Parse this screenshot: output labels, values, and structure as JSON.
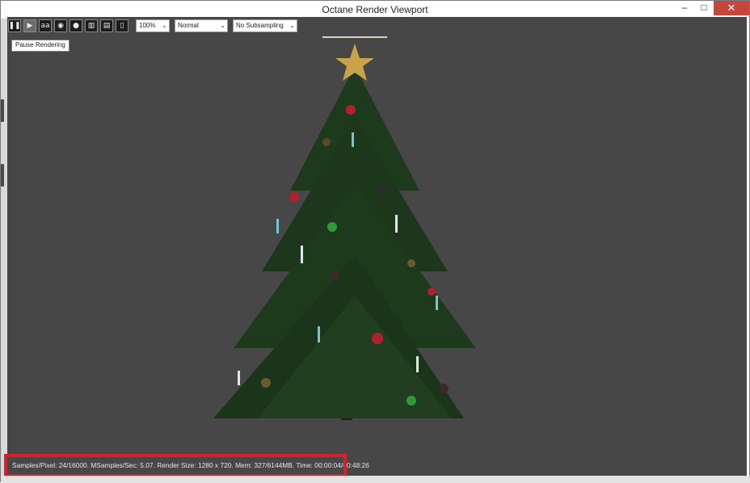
{
  "window": {
    "title": "Octane Render Viewport",
    "controls": {
      "minimize": "–",
      "maximize": "□",
      "close": "✕"
    }
  },
  "toolbar": {
    "buttons": [
      {
        "name": "pause-icon",
        "glyph": "❚❚"
      },
      {
        "name": "play-icon",
        "glyph": "▶"
      },
      {
        "name": "aa-icon",
        "glyph": "aa"
      },
      {
        "name": "color-icon",
        "glyph": "◉"
      },
      {
        "name": "sphere-icon",
        "glyph": "●"
      },
      {
        "name": "region-icon",
        "glyph": "▥"
      },
      {
        "name": "save-image-icon",
        "glyph": "▤"
      },
      {
        "name": "device-icon",
        "glyph": "▯"
      }
    ],
    "zoom": "100%",
    "mode": "Normal",
    "subsampling": "No Subsampling"
  },
  "tooltip": {
    "text": "Pause Rendering"
  },
  "status": {
    "text": "Samples/Pixel: 24/16000. MSamples/Sec: 5.07. Render Size: 1280 x 720. Mem: 327/6144MB. Time: 00:00:04/00:48:26"
  },
  "colors": {
    "viewport_bg": "#474747",
    "highlight": "#d8202a",
    "close_button": "#c7463b",
    "tree_green": "#1e3a1c"
  }
}
